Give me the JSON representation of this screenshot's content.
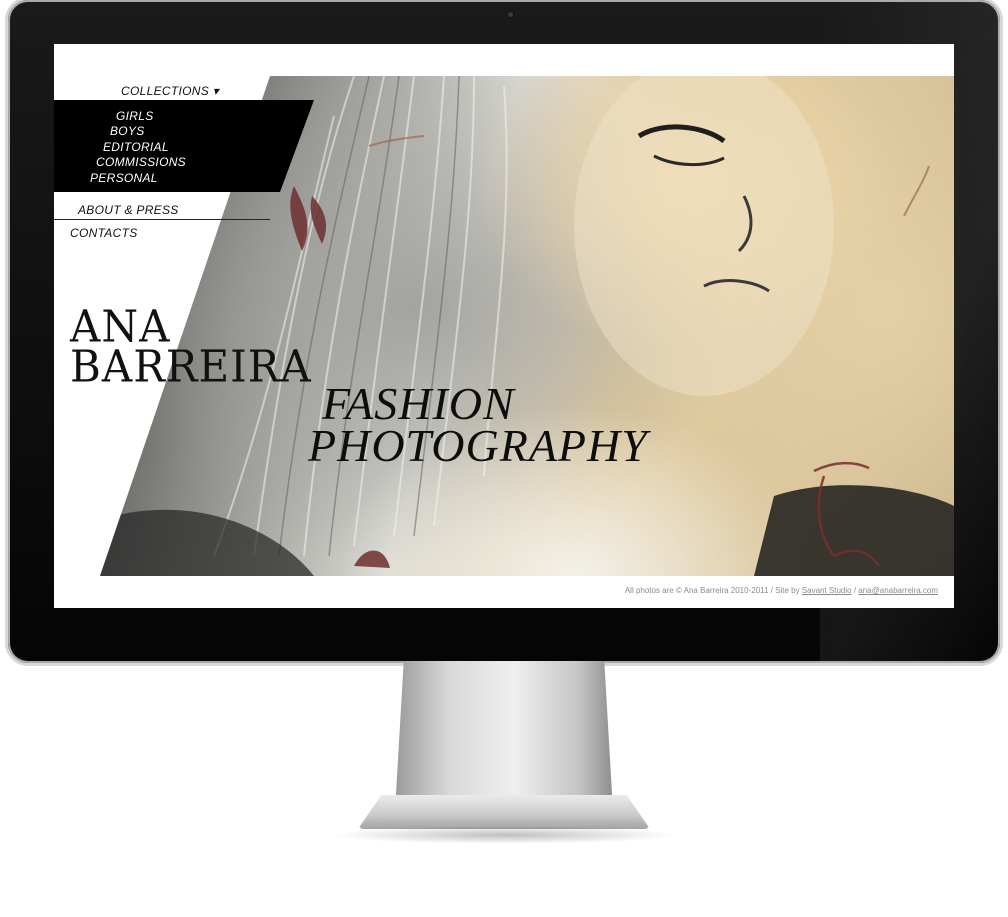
{
  "site": {
    "nav": {
      "collections_label": "COLLECTIONS ▾",
      "items": [
        {
          "label": "GIRLS"
        },
        {
          "label": "BOYS"
        },
        {
          "label": "EDITORIAL"
        },
        {
          "label": "COMMISSIONS"
        },
        {
          "label": "PERSONAL"
        }
      ],
      "about_label": "ABOUT & PRESS",
      "contacts_label": "CONTACTS"
    },
    "name_line1": "ANA",
    "name_line2": "BARREIRA",
    "tagline_line1": "FASHION",
    "tagline_line2": "PHOTOGRAPHY",
    "footer": {
      "prefix": "All photos are © Ana Barreira 2010-2011 / Site by ",
      "studio_link": "Savant Studio",
      "separator": " / ",
      "email_link": "ana@anabarreira.com"
    }
  },
  "colors": {
    "bezel": "#0b0b0b",
    "screen_bg": "#ffffff",
    "nav_black": "#000000",
    "photo_warm": "#e2cc9f",
    "footer_text": "#8a8a8a"
  }
}
